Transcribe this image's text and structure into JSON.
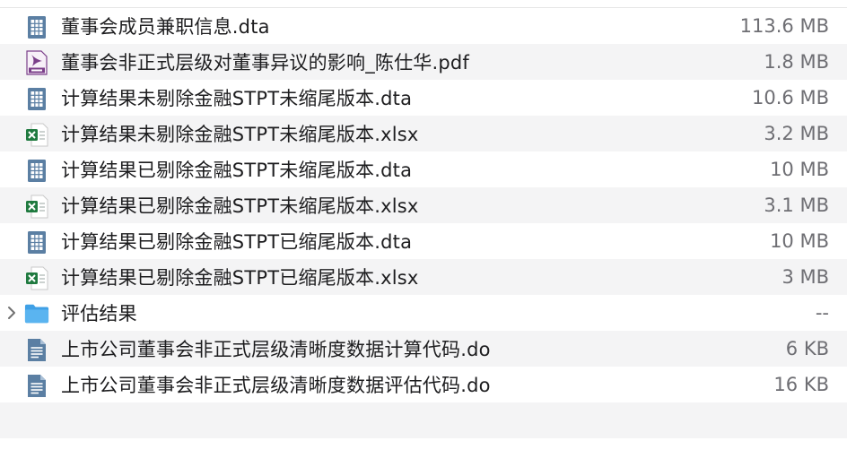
{
  "files": [
    {
      "name": "董事会成员兼职信息.dta",
      "size": "113.6 MB",
      "icon": "dta-file-icon"
    },
    {
      "name": "董事会非正式层级对董事异议的影响_陈仕华.pdf",
      "size": "1.8 MB",
      "icon": "pdf-file-icon"
    },
    {
      "name": "计算结果未剔除金融STPT未缩尾版本.dta",
      "size": "10.6 MB",
      "icon": "dta-file-icon"
    },
    {
      "name": "计算结果未剔除金融STPT未缩尾版本.xlsx",
      "size": "3.2 MB",
      "icon": "excel-file-icon"
    },
    {
      "name": "计算结果已剔除金融STPT未缩尾版本.dta",
      "size": "10 MB",
      "icon": "dta-file-icon"
    },
    {
      "name": "计算结果已剔除金融STPT未缩尾版本.xlsx",
      "size": "3.1 MB",
      "icon": "excel-file-icon"
    },
    {
      "name": "计算结果已剔除金融STPT已缩尾版本.dta",
      "size": "10 MB",
      "icon": "dta-file-icon"
    },
    {
      "name": "计算结果已剔除金融STPT已缩尾版本.xlsx",
      "size": "3 MB",
      "icon": "excel-file-icon"
    },
    {
      "name": "评估结果",
      "size": "--",
      "icon": "folder-icon",
      "folder": true
    },
    {
      "name": "上市公司董事会非正式层级清晰度数据计算代码.do",
      "size": "6 KB",
      "icon": "do-file-icon"
    },
    {
      "name": "上市公司董事会非正式层级清晰度数据评估代码.do",
      "size": "16 KB",
      "icon": "do-file-icon"
    }
  ],
  "colors": {
    "stripe": "#f4f4f5",
    "doc_blue": "#5b7fa3",
    "excel_green": "#1f7a3f",
    "pdf_purple": "#7b3f8a",
    "folder_blue": "#5ab4f0"
  }
}
